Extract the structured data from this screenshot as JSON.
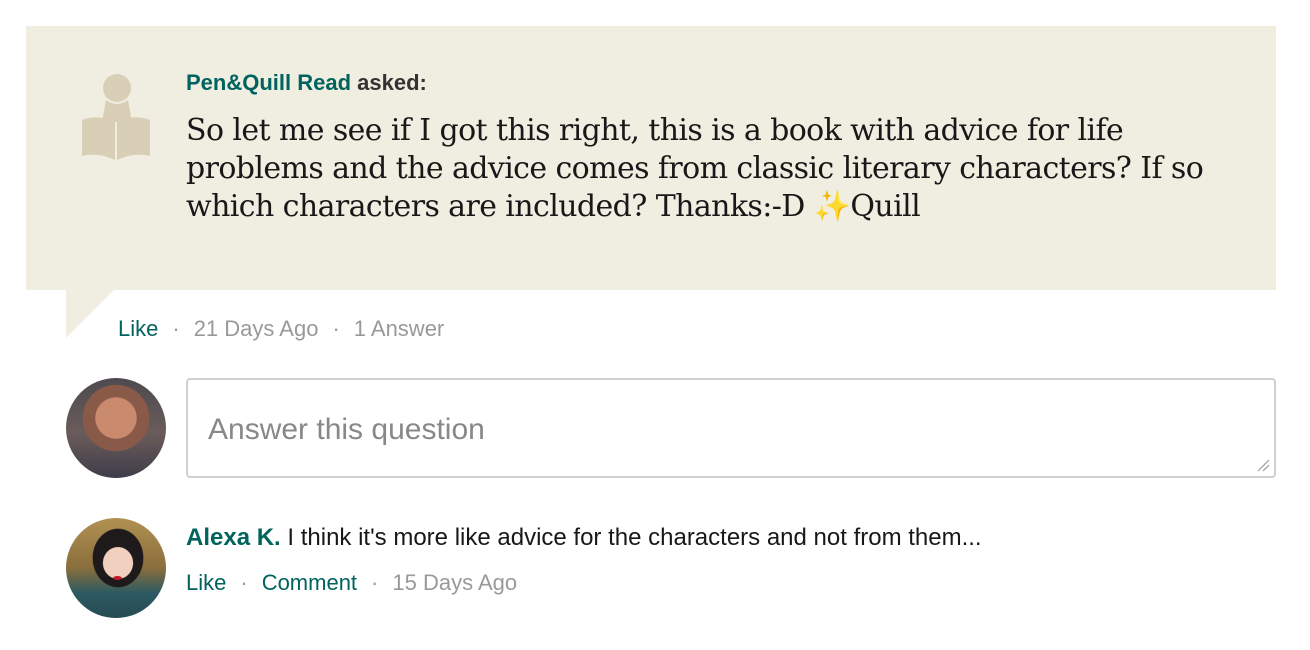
{
  "question": {
    "asker_name": "Pen&Quill Read",
    "asked_label": "asked:",
    "text": "So let me see if I got this right, this is a book with advice for life problems and the advice comes from classic literary characters? If so which characters are included? Thanks:-D ✨Quill",
    "like_label": "Like",
    "age": "21 Days Ago",
    "answer_count": "1 Answer",
    "separator": "·"
  },
  "answer_box": {
    "placeholder": "Answer this question",
    "value": ""
  },
  "answer": {
    "author": "Alexa K.",
    "text": "I think it's more like advice for the characters and not from them...",
    "like_label": "Like",
    "comment_label": "Comment",
    "age": "15 Days Ago"
  },
  "colors": {
    "accent": "#00635d",
    "question_bg": "#f0ede1",
    "muted": "#999999"
  },
  "icons": {
    "reader": "reader-with-book-icon",
    "resize": "resize-grip-icon"
  }
}
